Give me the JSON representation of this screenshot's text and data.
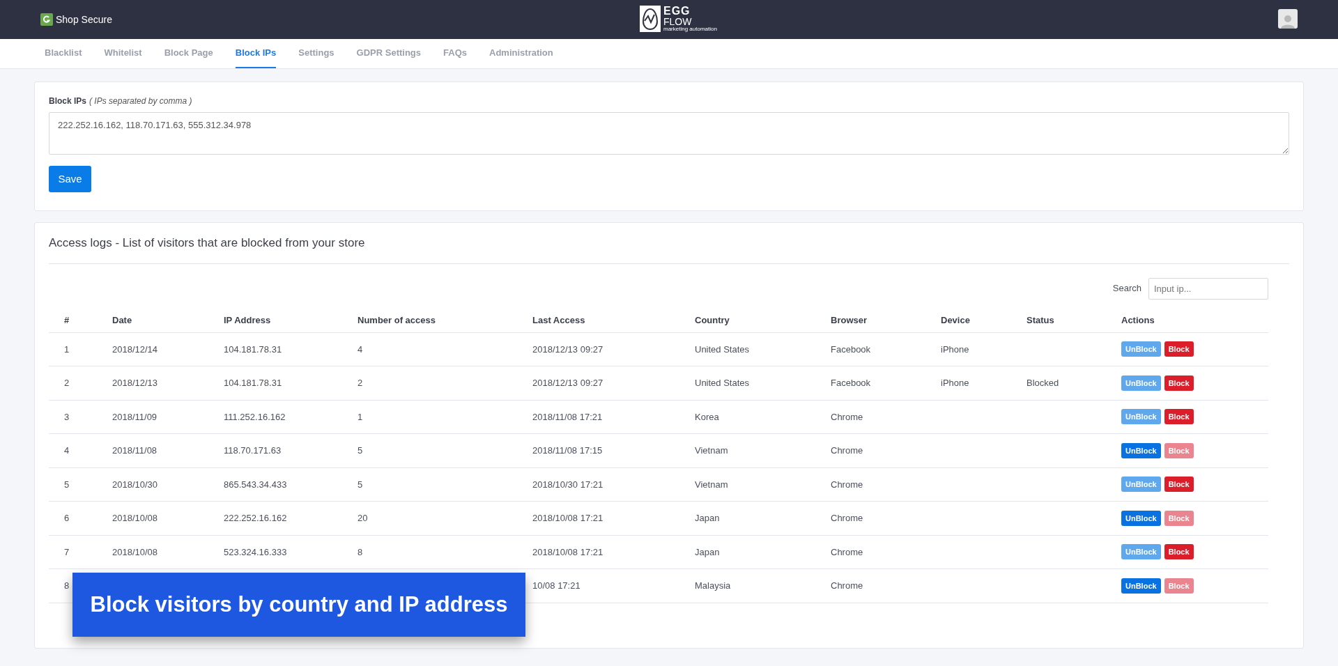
{
  "header": {
    "app_name": "Shop Secure",
    "logo": {
      "line_1": "EGG",
      "line_2": "FLOW",
      "tagline": "marketing automation"
    }
  },
  "tabs": [
    {
      "label": "Blacklist",
      "selected": false
    },
    {
      "label": "Whitelist",
      "selected": false
    },
    {
      "label": "Block Page",
      "selected": false
    },
    {
      "label": "Block IPs",
      "selected": true
    },
    {
      "label": "Settings",
      "selected": false
    },
    {
      "label": "GDPR Settings",
      "selected": false
    },
    {
      "label": "FAQs",
      "selected": false
    },
    {
      "label": "Administration",
      "selected": false
    }
  ],
  "block_form": {
    "label": "Block IPs",
    "hint": "( IPs separated by comma )",
    "value": "222.252.16.162, 118.70.171.63, 555.312.34.978",
    "button": "Save"
  },
  "access_logs": {
    "title": "Access logs - List of visitors that are blocked from your store",
    "search_label": "Search",
    "search_placeholder": "Input ip...",
    "columns": [
      "#",
      "Date",
      "IP Address",
      "Number of access",
      "Last Access",
      "Country",
      "Browser",
      "Device",
      "Status",
      "Actions"
    ],
    "rows": [
      {
        "number": "1",
        "date": "2018/12/14",
        "ip": "104.181.78.31",
        "count": "4",
        "last_access": "2018/12/13 09:27",
        "country": "United States",
        "browser": "Facebook",
        "device": "iPhone",
        "unblock": "UnBlock",
        "block": "Block",
        "unblock_disabled": true,
        "block_disabled": false
      },
      {
        "number": "2",
        "date": "2018/12/13",
        "ip": "104.181.78.31",
        "count": "2",
        "last_access": "2018/12/13 09:27",
        "country": "United States",
        "browser": "Facebook",
        "device": "iPhone",
        "status": "Blocked",
        "unblock": "UnBlock",
        "block": "Block",
        "unblock_disabled": true,
        "block_disabled": false
      },
      {
        "number": "3",
        "date": "2018/11/09",
        "ip": "111.252.16.162",
        "count": "1",
        "last_access": "2018/11/08 17:21",
        "country": "Korea",
        "browser": "Chrome",
        "unblock": "UnBlock",
        "block": "Block",
        "unblock_disabled": true,
        "block_disabled": false
      },
      {
        "number": "4",
        "date": "2018/11/08",
        "ip": "118.70.171.63",
        "count": "5",
        "last_access": "2018/11/08 17:15",
        "country": "Vietnam",
        "browser": "Chrome",
        "unblock": "UnBlock",
        "block": "Block",
        "unblock_disabled": false,
        "block_disabled": true
      },
      {
        "number": "5",
        "date": "2018/10/30",
        "ip": "865.543.34.433",
        "count": "5",
        "last_access": "2018/10/30 17:21",
        "country": "Vietnam",
        "browser": "Chrome",
        "unblock": "UnBlock",
        "block": "Block",
        "unblock_disabled": true,
        "block_disabled": false
      },
      {
        "number": "6",
        "date": "2018/10/08",
        "ip": "222.252.16.162",
        "count": "20",
        "last_access": "2018/10/08 17:21",
        "country": "Japan",
        "browser": "Chrome",
        "unblock": "UnBlock",
        "block": "Block",
        "unblock_disabled": false,
        "block_disabled": true
      },
      {
        "number": "7",
        "date": "2018/10/08",
        "ip": "523.324.16.333",
        "count": "8",
        "last_access": "2018/10/08 17:21",
        "country": "Japan",
        "browser": "Chrome",
        "unblock": "UnBlock",
        "block": "Block",
        "unblock_disabled": true,
        "block_disabled": false
      },
      {
        "number": "8",
        "last_access": "10/08 17:21",
        "country": "Malaysia",
        "browser": "Chrome",
        "unblock": "UnBlock",
        "block": "Block",
        "unblock_disabled": false,
        "block_disabled": true
      }
    ]
  },
  "banner": {
    "text": "Block visitors by country and IP address"
  }
}
